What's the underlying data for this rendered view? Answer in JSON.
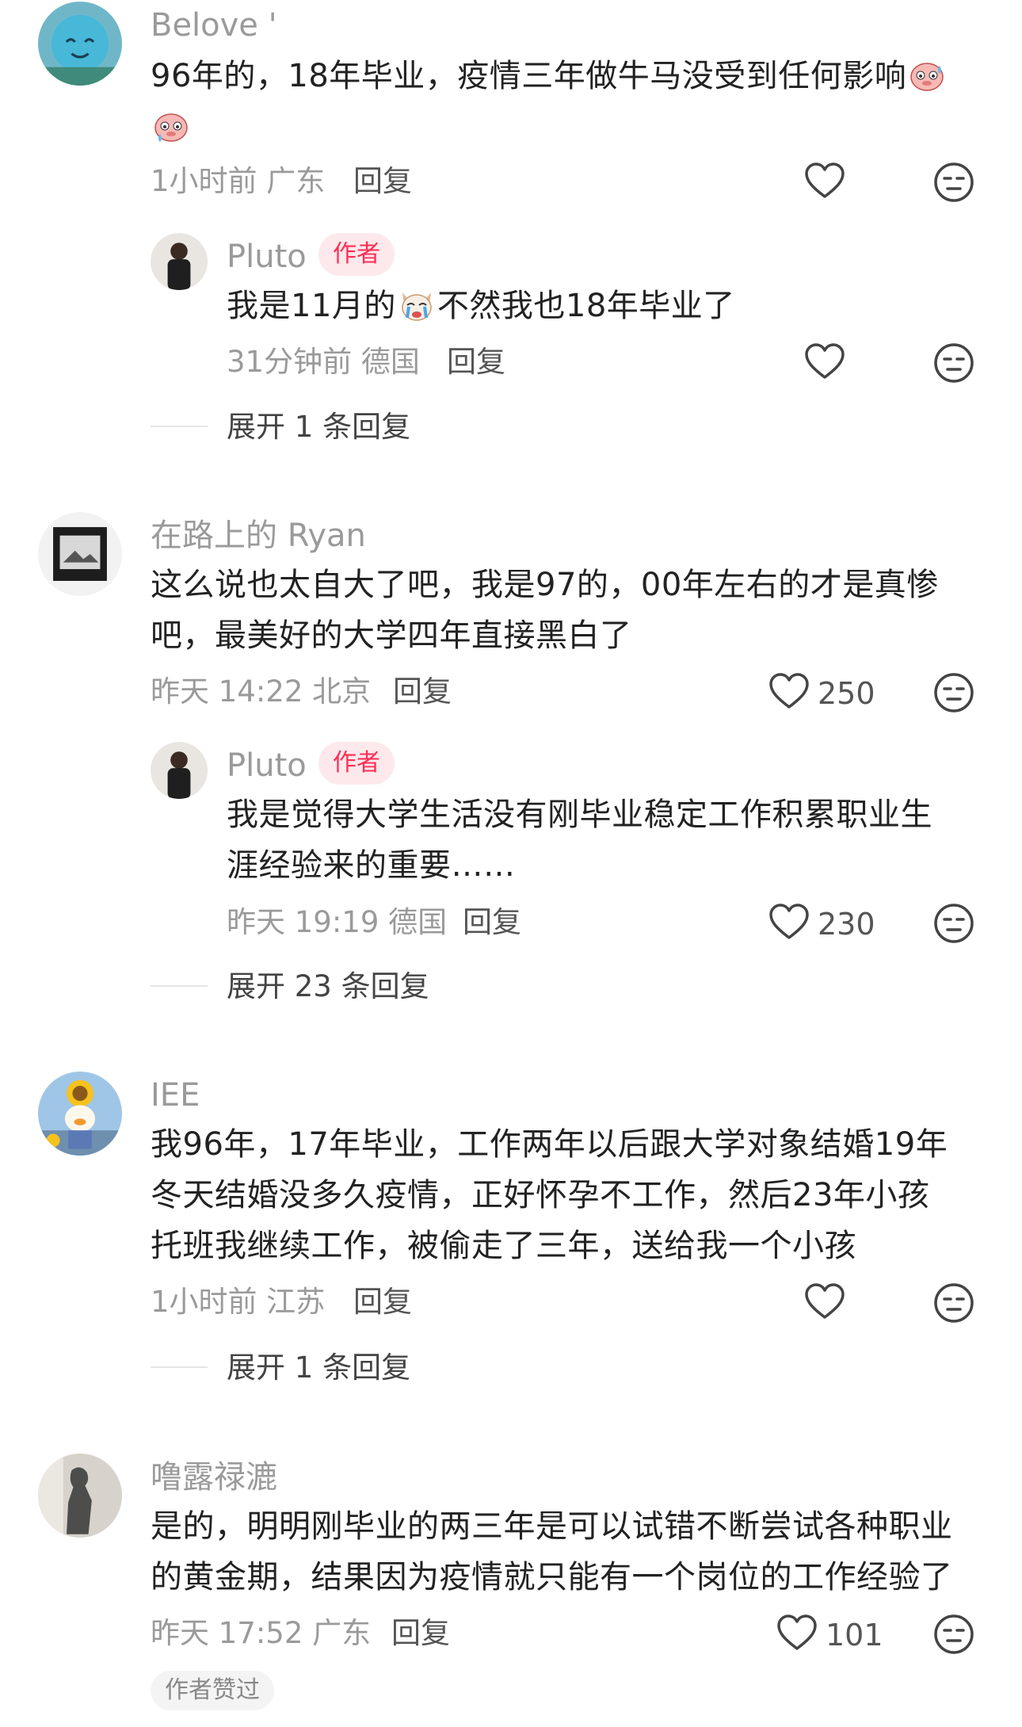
{
  "comments": [
    {
      "user": "Belove '",
      "lines": [
        "96年的，18年毕业，疫情三年做牛马没受到任何影响"
      ],
      "meta": "1小时前 广东",
      "reply_label": "回复",
      "avatar_icon": "blue-cartoon-avatar",
      "reply": {
        "user": "Pluto",
        "badge": "作者",
        "text_before": "我是11月的",
        "text_after": "不然我也18年毕业了",
        "meta": "31分钟前 德国",
        "reply_label": "回复"
      },
      "expand": "展开 1 条回复"
    },
    {
      "user": "在路上的 Ryan",
      "lines": [
        "这么说也太自大了吧，我是97的，00年左右的才是真惨",
        "吧，最美好的大学四年直接黑白了"
      ],
      "meta": "昨天 14:22 北京",
      "reply_label": "回复",
      "likes": "250",
      "avatar_icon": "photo-avatar",
      "reply": {
        "user": "Pluto",
        "badge": "作者",
        "lines": [
          "我是觉得大学生活没有刚毕业稳定工作积累职业生",
          "涯经验来的重要……"
        ],
        "meta": "昨天 19:19 德国",
        "reply_label": "回复",
        "likes": "230"
      },
      "expand": "展开 23 条回复"
    },
    {
      "user": "IEE",
      "lines": [
        "我96年，17年毕业，工作两年以后跟大学对象结婚19年",
        "冬天结婚没多久疫情，正好怀孕不工作，然后23年小孩",
        "托班我继续工作，被偷走了三年，送给我一个小孩"
      ],
      "meta": "1小时前 江苏",
      "reply_label": "回复",
      "avatar_icon": "sunflower-duck-avatar",
      "expand": "展开 1 条回复"
    },
    {
      "user": "噜露禄漉",
      "lines": [
        "是的，明明刚毕业的两三年是可以试错不断尝试各种职业",
        "的黄金期，结果因为疫情就只能有一个岗位的工作经验了"
      ],
      "meta": "昨天 17:52 广东",
      "reply_label": "回复",
      "likes": "101",
      "avatar_icon": "statue-avatar",
      "liked_tag": "作者赞过"
    }
  ],
  "icons": {
    "like": "heart-outline-icon",
    "dislike": "unamused-face-icon",
    "emoji_1": "sweat-pig-emoji",
    "emoji_2": "crying-dog-emoji"
  },
  "colors": {
    "badge_bg": "#fde9ec",
    "badge_text": "#ff2d55",
    "meta": "#9a9a9a"
  }
}
